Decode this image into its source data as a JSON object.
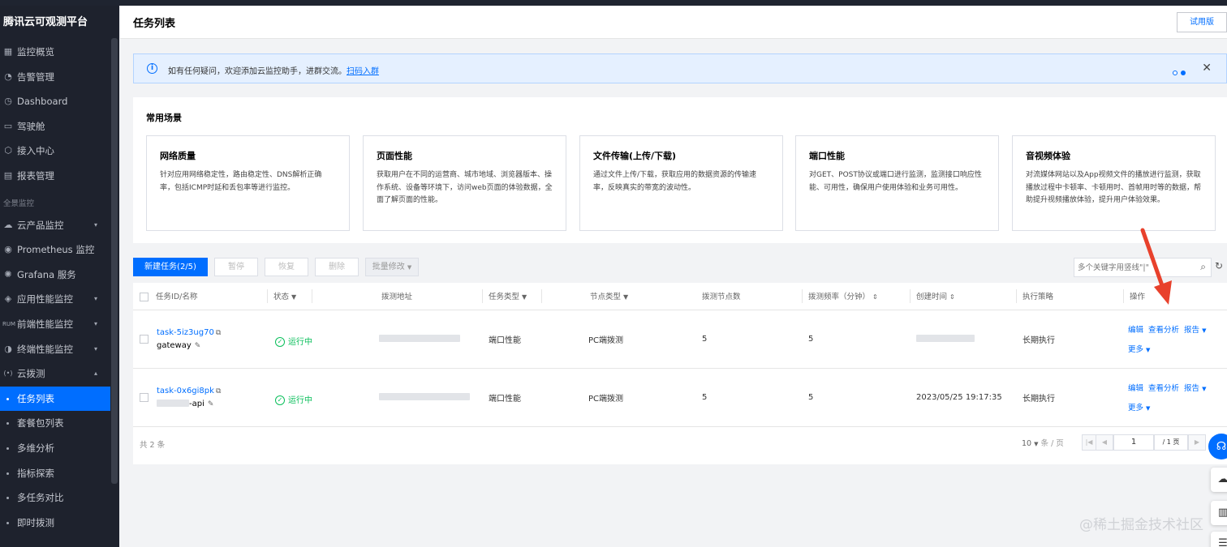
{
  "sidebar": {
    "brand": "腾讯云可观测平台",
    "items_top": [
      {
        "label": "监控概览",
        "icon": "grid-icon"
      },
      {
        "label": "告警管理",
        "icon": "alarm-icon"
      },
      {
        "label": "Dashboard",
        "icon": "clock-icon"
      },
      {
        "label": "驾驶舱",
        "icon": "cockpit-icon"
      },
      {
        "label": "接入中心",
        "icon": "cube-icon"
      },
      {
        "label": "报表管理",
        "icon": "report-icon"
      }
    ],
    "section": "全景监控",
    "items_mid": [
      {
        "label": "云产品监控",
        "icon": "cloud-icon"
      },
      {
        "label": "Prometheus 监控",
        "icon": "prometheus-icon"
      },
      {
        "label": "Grafana 服务",
        "icon": "grafana-icon"
      },
      {
        "label": "应用性能监控",
        "icon": "apm-icon"
      },
      {
        "label": "前端性能监控",
        "icon": "rum-icon"
      },
      {
        "label": "终端性能监控",
        "icon": "terminal-icon"
      },
      {
        "label": "云拨测",
        "icon": "probe-icon"
      }
    ],
    "sub_items": [
      "任务列表",
      "套餐包列表",
      "多维分析",
      "指标探索",
      "多任务对比",
      "即时拨测"
    ]
  },
  "header": {
    "title": "任务列表",
    "trial": "试用版"
  },
  "notice": {
    "text": "如有任何疑问，欢迎添加云监控助手，进群交流。",
    "link": "扫码入群"
  },
  "scenes": {
    "title": "常用场景",
    "cards": [
      {
        "title": "网络质量",
        "desc": "针对应用网络稳定性，路由稳定性、DNS解析正确率，包括ICMP时延和丢包率等进行监控。"
      },
      {
        "title": "页面性能",
        "desc": "获取用户在不同的运营商、城市地域、浏览器版本、操作系统、设备等环境下，访问web页面的体验数据，全面了解页面的性能。"
      },
      {
        "title": "文件传输(上传/下载)",
        "desc": "通过文件上传/下载，获取应用的数据资源的传输速率，反映真实的带宽的波动性。"
      },
      {
        "title": "端口性能",
        "desc": "对GET、POST协议或端口进行监测，监测接口响应性能、可用性，确保用户使用体验和业务可用性。"
      },
      {
        "title": "音视频体验",
        "desc": "对流媒体网站以及App视频文件的播放进行监测，获取播放过程中卡顿率、卡顿用时、首帧用时等的数据，帮助提升视频播放体验，提升用户体验效果。"
      }
    ]
  },
  "toolbar": {
    "new_task": "新建任务(2/5)",
    "pause": "暂停",
    "resume": "恢复",
    "delete": "删除",
    "batch": "批量修改",
    "search_placeholder": "多个关键字用竖线\"|\""
  },
  "table": {
    "headers": [
      "任务ID/名称",
      "状态",
      "拨测地址",
      "任务类型",
      "节点类型",
      "拨测节点数",
      "拨测频率（分钟）",
      "创建时间",
      "执行策略",
      "操作"
    ],
    "rows": [
      {
        "id": "task-5iz3ug70",
        "name": "gateway",
        "status": "运行中",
        "type": "端口性能",
        "node_type": "PC端拨测",
        "nodes": "5",
        "freq": "5",
        "created": "",
        "policy": "长期执行"
      },
      {
        "id": "task-0x6gi8pk",
        "name": "-api",
        "status": "运行中",
        "type": "端口性能",
        "node_type": "PC端拨测",
        "nodes": "5",
        "freq": "5",
        "created": "2023/05/25 19:17:35",
        "policy": "长期执行"
      }
    ],
    "ops": {
      "edit": "编辑",
      "analyze": "查看分析",
      "report": "报告",
      "more": "更多"
    }
  },
  "footer": {
    "total": "共 2 条",
    "page_size": "10",
    "per_page": "条 / 页",
    "page": "1",
    "page_total": "/ 1 页"
  },
  "watermark": "@稀土掘金技术社区",
  "colors": {
    "accent": "#006eff",
    "running": "#0abf5b",
    "sidebar_bg": "#1e222d",
    "annotation_arrow": "#e8412c"
  }
}
